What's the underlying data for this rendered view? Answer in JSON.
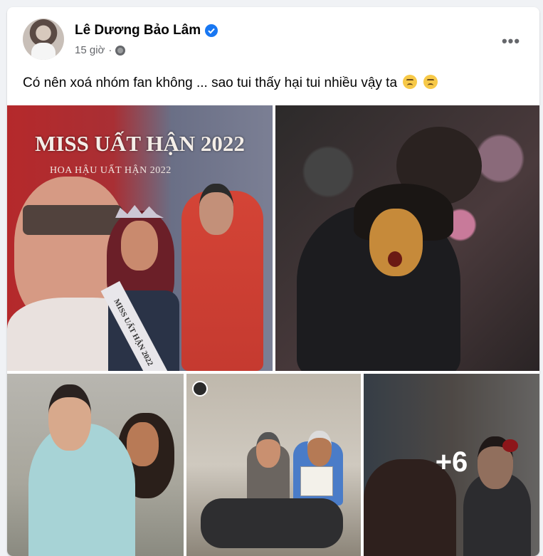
{
  "post": {
    "author": "Lê Dương Bảo Lâm",
    "time": "15 giờ",
    "text": "Có nên xoá nhóm fan không ... sao tui thấy hại tui nhiều vậy ta",
    "emoji_icons": [
      "weary-face-icon",
      "weary-face-icon"
    ],
    "privacy_icon": "globe-icon",
    "options_icon": "more-horizontal-icon"
  },
  "photos": {
    "p1": {
      "title": "MISS UẤT HẬN 2022",
      "subtitle": "HOA HẬU UẤT HẬN 2022",
      "sash": "MISS UẤT HẬN 2022"
    },
    "more_count": "+6"
  },
  "colors": {
    "accent": "#1877f2",
    "background": "#f0f2f5",
    "card": "#ffffff",
    "secondary_text": "#65676b"
  }
}
